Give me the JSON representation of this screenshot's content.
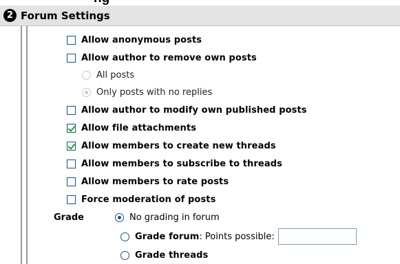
{
  "page_heading": "ng",
  "section": {
    "step_number": "2",
    "title": "Forum Settings"
  },
  "options": {
    "anonymous": {
      "label": "Allow anonymous posts",
      "checked": false
    },
    "author_remove": {
      "label": "Allow author to remove own posts",
      "checked": false
    },
    "remove_all": {
      "label": "All posts",
      "selected": false,
      "enabled": false
    },
    "remove_no_replies": {
      "label": "Only posts with no replies",
      "selected": true,
      "enabled": false
    },
    "author_modify": {
      "label": "Allow author to modify own published posts",
      "checked": false
    },
    "file_attachments": {
      "label": "Allow file attachments",
      "checked": true
    },
    "create_threads": {
      "label": "Allow members to create new threads",
      "checked": true
    },
    "subscribe": {
      "label": "Allow members to subscribe to threads",
      "checked": false
    },
    "rate_posts": {
      "label": "Allow members to rate posts",
      "checked": false
    },
    "force_moderation": {
      "label": "Force moderation of posts",
      "checked": false
    }
  },
  "grade": {
    "label": "Grade",
    "no_grading": {
      "label": "No grading in forum",
      "selected": true
    },
    "grade_forum": {
      "label": "Grade forum",
      "suffix": ": Points possible:",
      "selected": false,
      "points_value": ""
    },
    "grade_threads": {
      "label": "Grade threads",
      "selected": false
    }
  }
}
